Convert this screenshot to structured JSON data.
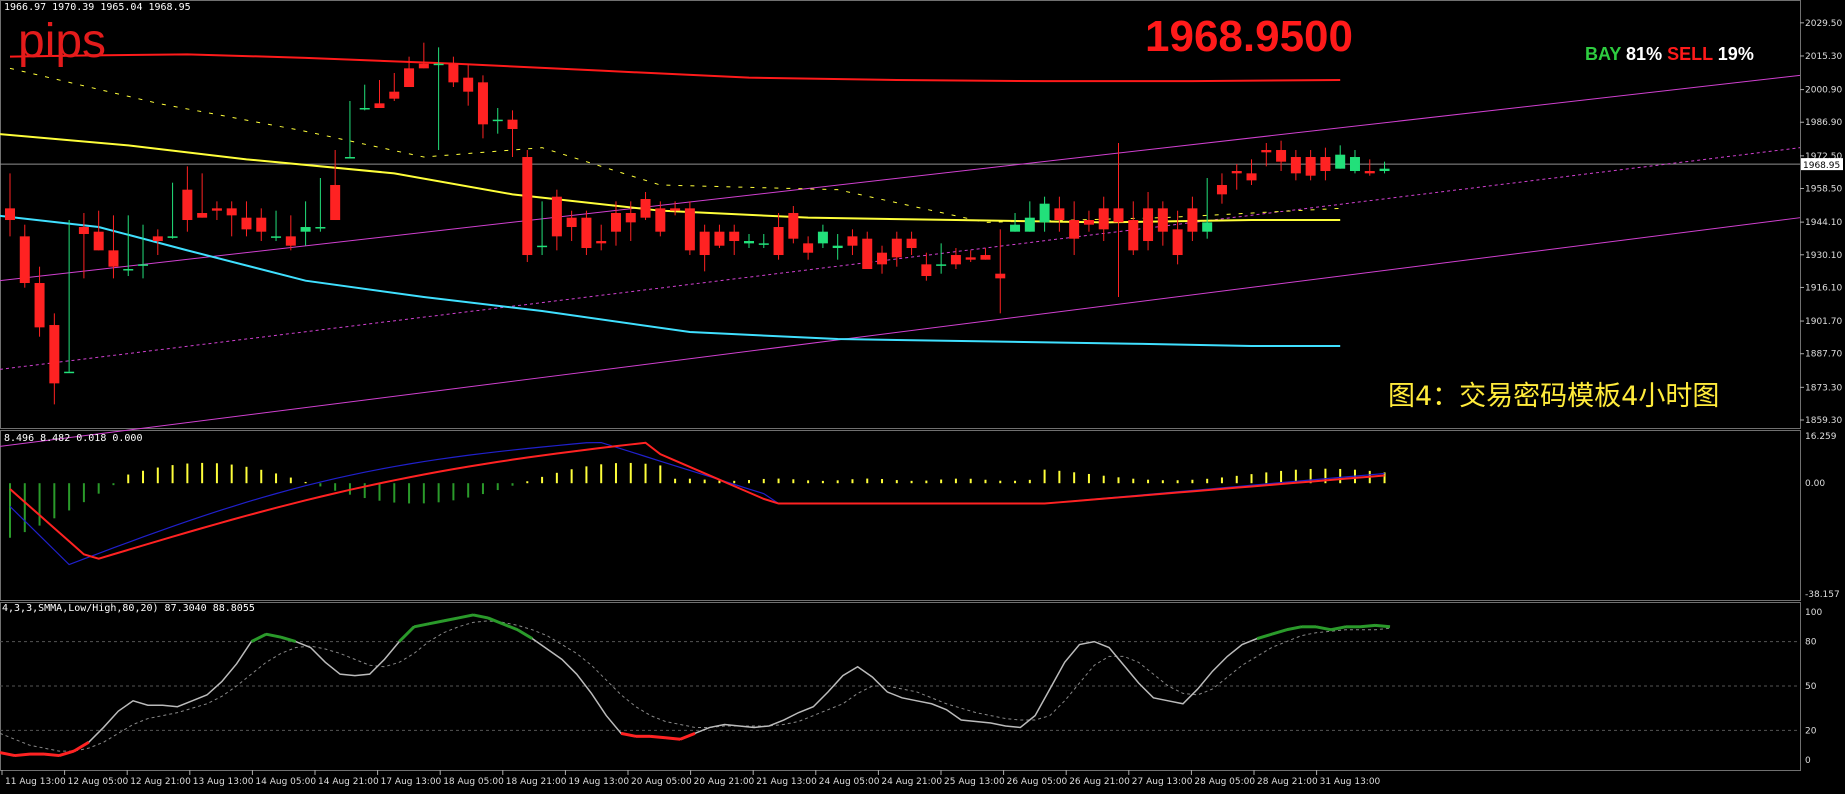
{
  "header": {
    "ohlc_text": "1966.97 1970.39 1965.04 1968.95",
    "pips_label": "pips",
    "current_price_big": "1968.9500",
    "bay_label": "BAY",
    "bay_pct": "81%",
    "sell_label": "SELL",
    "sell_pct": "19%",
    "caption": "图4：交易密码模板4小时图"
  },
  "macd": {
    "values_text": "8.496 8.482 0.018 0.000"
  },
  "stoch": {
    "values_text": "4,3,3,SMMA,Low/High,80,20) 87.3040 88.8055"
  },
  "colors": {
    "bull": "#22e07a",
    "bear": "#ff2222",
    "upper_band": "#ff1a1a",
    "ma_yellow": "#ffff3a",
    "ma_cyan": "#40e0ff",
    "channel": "#d040d0",
    "macd_signal": "#ff2222",
    "macd_line": "#2020cc",
    "stoch_main": "#bbbbbb"
  },
  "chart_data": [
    {
      "type": "candlestick",
      "price_axis_ticks": [
        "2029.50",
        "2015.30",
        "2000.90",
        "1986.90",
        "1972.50",
        "1958.50",
        "1944.10",
        "1930.10",
        "1916.10",
        "1901.70",
        "1887.70",
        "1873.30",
        "1859.30"
      ],
      "current_price_tag": "1968.95",
      "ylim": [
        1859.3,
        2035
      ],
      "time_labels": [
        "11 Aug 13:00",
        "12 Aug 05:00",
        "12 Aug 21:00",
        "13 Aug 13:00",
        "14 Aug 05:00",
        "14 Aug 21:00",
        "17 Aug 13:00",
        "18 Aug 05:00",
        "18 Aug 21:00",
        "19 Aug 13:00",
        "20 Aug 05:00",
        "20 Aug 21:00",
        "21 Aug 13:00",
        "24 Aug 05:00",
        "24 Aug 21:00",
        "25 Aug 13:00",
        "26 Aug 05:00",
        "26 Aug 21:00",
        "27 Aug 13:00",
        "28 Aug 05:00",
        "28 Aug 21:00",
        "31 Aug 13:00"
      ],
      "candles": [
        [
          1950,
          1962,
          1945,
          1938
        ],
        [
          1938,
          1940,
          1918,
          1916
        ],
        [
          1918,
          1922,
          1899,
          1895
        ],
        [
          1900,
          1902,
          1875,
          1866
        ],
        [
          1880,
          1942,
          1880,
          1942
        ],
        [
          1942,
          1945,
          1939,
          1920
        ],
        [
          1940,
          1946,
          1932,
          1932
        ],
        [
          1932,
          1944,
          1925,
          1920
        ],
        [
          1924,
          1944,
          1924,
          1921
        ],
        [
          1926,
          1940,
          1926,
          1920
        ],
        [
          1938,
          1938,
          1936,
          1930
        ],
        [
          1938,
          1958,
          1938,
          1937
        ],
        [
          1958,
          1965,
          1945,
          1940
        ],
        [
          1948,
          1962,
          1946,
          1946
        ],
        [
          1950,
          1950,
          1949,
          1945
        ],
        [
          1950,
          1950,
          1947,
          1938
        ],
        [
          1946,
          1950,
          1941,
          1938
        ],
        [
          1946,
          1947,
          1940,
          1936
        ],
        [
          1938,
          1946,
          1938,
          1936
        ],
        [
          1938,
          1944,
          1934,
          1932
        ],
        [
          1940,
          1950,
          1942,
          1934
        ],
        [
          1942,
          1960,
          1942,
          1940
        ],
        [
          1960,
          1972,
          1945,
          1945
        ],
        [
          1972,
          1993,
          1972,
          1972
        ],
        [
          1993,
          2000,
          1993,
          1992
        ],
        [
          1995,
          2002,
          1993,
          1993
        ],
        [
          2000,
          2005,
          1997,
          1996
        ],
        [
          2010,
          2012,
          2002,
          2002
        ],
        [
          2012,
          2018,
          2010,
          2010
        ],
        [
          2012,
          2016,
          2012,
          1975
        ],
        [
          2012,
          2010,
          2004,
          2002
        ],
        [
          2006,
          2009,
          2000,
          1994
        ],
        [
          2004,
          1996,
          1986,
          1980
        ],
        [
          1988,
          1990,
          1988,
          1982
        ],
        [
          1988,
          1989,
          1984,
          1972
        ],
        [
          1972,
          1964,
          1930,
          1927
        ],
        [
          1934,
          1950,
          1934,
          1930
        ],
        [
          1955,
          1952,
          1938,
          1932
        ],
        [
          1946,
          1946,
          1942,
          1936
        ],
        [
          1946,
          1946,
          1933,
          1930
        ],
        [
          1936,
          1940,
          1935,
          1932
        ],
        [
          1948,
          1950,
          1940,
          1934
        ],
        [
          1948,
          1950,
          1944,
          1936
        ],
        [
          1954,
          1952,
          1946,
          1945
        ],
        [
          1950,
          1948,
          1940,
          1938
        ],
        [
          1950,
          1949,
          1949,
          1947
        ],
        [
          1950,
          1945,
          1932,
          1930
        ],
        [
          1940,
          1940,
          1930,
          1923
        ],
        [
          1940,
          1937,
          1934,
          1933
        ],
        [
          1940,
          1938,
          1936,
          1930
        ],
        [
          1935,
          1935,
          1936,
          1933
        ],
        [
          1935,
          1936,
          1935,
          1933
        ],
        [
          1942,
          1945,
          1930,
          1928
        ],
        [
          1948,
          1946,
          1937,
          1935
        ],
        [
          1935,
          1934,
          1931,
          1928
        ],
        [
          1935,
          1940,
          1940,
          1933
        ],
        [
          1933,
          1936,
          1934,
          1928
        ],
        [
          1938,
          1938,
          1934,
          1930
        ],
        [
          1937,
          1931,
          1924,
          1924
        ],
        [
          1931,
          1930,
          1926,
          1922
        ],
        [
          1937,
          1933,
          1929,
          1925
        ],
        [
          1937,
          1935,
          1933,
          1930
        ],
        [
          1926,
          1928,
          1921,
          1919
        ],
        [
          1926,
          1932,
          1926,
          1922
        ],
        [
          1930,
          1929,
          1926,
          1924
        ],
        [
          1929,
          1929,
          1928,
          1927
        ],
        [
          1930,
          1921,
          1928,
          1930
        ],
        [
          1922,
          1938,
          1920,
          1905
        ],
        [
          1940,
          1945,
          1943,
          1942
        ],
        [
          1940,
          1950,
          1946,
          1940
        ],
        [
          1944,
          1945,
          1952,
          1940
        ],
        [
          1950,
          1952,
          1945,
          1940
        ],
        [
          1945,
          1950,
          1937,
          1930
        ],
        [
          1945,
          1946,
          1943,
          1940
        ],
        [
          1950,
          1952,
          1941,
          1936
        ],
        [
          1950,
          1975,
          1944,
          1912
        ],
        [
          1945,
          1950,
          1932,
          1930
        ],
        [
          1950,
          1954,
          1936,
          1932
        ],
        [
          1950,
          1950,
          1940,
          1934
        ],
        [
          1941,
          1946,
          1930,
          1926
        ],
        [
          1950,
          1952,
          1940,
          1936
        ],
        [
          1940,
          1960,
          1944,
          1937
        ],
        [
          1960,
          1962,
          1956,
          1952
        ],
        [
          1966,
          1962,
          1965,
          1958
        ],
        [
          1965,
          1968,
          1962,
          1960
        ],
        [
          1975,
          1972,
          1974,
          1968
        ],
        [
          1975,
          1976,
          1970,
          1966
        ],
        [
          1972,
          1972,
          1965,
          1962
        ],
        [
          1972,
          1971,
          1964,
          1962
        ],
        [
          1972,
          1973,
          1966,
          1962
        ],
        [
          1967,
          1974,
          1973,
          1967
        ],
        [
          1966,
          1968,
          1972,
          1965
        ],
        [
          1966,
          1968,
          1965,
          1964
        ],
        [
          1966,
          1967,
          1967,
          1965
        ]
      ]
    },
    {
      "type": "bar+line",
      "name": "macd",
      "axis_ticks": [
        "16.259",
        "0.00",
        "-38.157"
      ],
      "ylim": [
        -38.157,
        16.259
      ]
    },
    {
      "type": "line",
      "name": "stochastic",
      "axis_ticks": [
        "100",
        "80",
        "50",
        "20",
        "0"
      ],
      "ylim": [
        0,
        100
      ],
      "main_values": [
        5,
        3,
        4,
        4,
        3,
        6,
        12,
        22,
        33,
        40,
        37,
        37,
        36,
        40,
        44,
        53,
        65,
        80,
        85,
        83,
        80,
        76,
        66,
        58,
        57,
        58,
        68,
        80,
        90,
        92,
        94,
        96,
        98,
        96,
        92,
        88,
        82,
        75,
        68,
        58,
        45,
        30,
        18,
        16,
        16,
        15,
        14,
        18,
        22,
        24,
        23,
        22,
        23,
        27,
        32,
        36,
        46,
        57,
        63,
        56,
        46,
        42,
        40,
        38,
        34,
        27,
        26,
        25,
        23,
        22,
        30,
        48,
        66,
        78,
        80,
        76,
        64,
        52,
        42,
        40,
        38,
        48,
        60,
        70,
        78,
        82,
        85,
        88,
        90,
        90,
        88,
        90,
        90,
        91,
        90
      ],
      "signal_values": [
        18,
        14,
        10,
        8,
        6,
        6,
        8,
        12,
        18,
        24,
        28,
        30,
        32,
        35,
        38,
        43,
        50,
        58,
        66,
        72,
        76,
        77,
        75,
        72,
        68,
        64,
        63,
        66,
        72,
        80,
        86,
        90,
        93,
        94,
        93,
        91,
        88,
        84,
        78,
        72,
        64,
        54,
        44,
        36,
        30,
        26,
        24,
        22,
        22,
        23,
        23,
        23,
        23,
        24,
        26,
        30,
        34,
        38,
        45,
        50,
        50,
        48,
        46,
        42,
        38,
        35,
        32,
        30,
        28,
        27,
        27,
        30,
        40,
        52,
        64,
        70,
        70,
        66,
        58,
        50,
        45,
        44,
        48,
        56,
        64,
        70,
        76,
        80,
        84,
        86,
        87,
        88,
        88,
        88,
        89
      ]
    }
  ]
}
